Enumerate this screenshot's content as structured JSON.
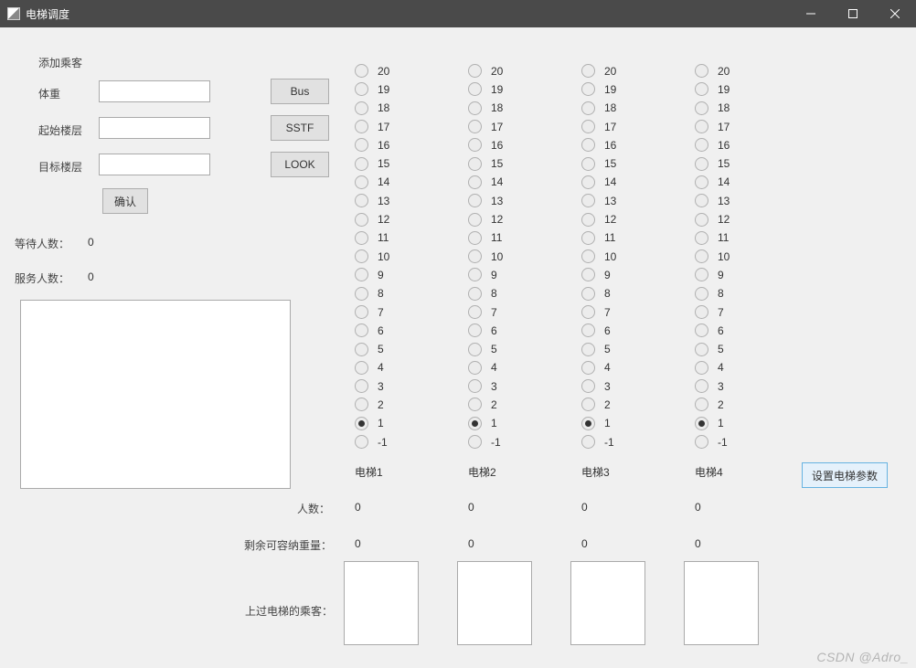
{
  "window": {
    "title": "电梯调度"
  },
  "panel": {
    "add_passenger": "添加乘客",
    "weight_label": "体重",
    "start_floor_label": "起始楼层",
    "target_floor_label": "目标楼层",
    "confirm": "确认"
  },
  "inputs": {
    "weight": "",
    "start_floor": "",
    "target_floor": ""
  },
  "algorithms": {
    "bus": "Bus",
    "sstf": "SSTF",
    "look": "LOOK"
  },
  "stats": {
    "waiting_label": "等待人数：",
    "served_label": "服务人数：",
    "waiting": "0",
    "served": "0"
  },
  "row_labels": {
    "count": "人数：",
    "remaining_weight": "剩余可容纳重量：",
    "boarded": "上过电梯的乘客："
  },
  "set_params_button": "设置电梯参数",
  "elevators": [
    {
      "name": "电梯1",
      "selected": 1,
      "count": "0",
      "remaining": "0"
    },
    {
      "name": "电梯2",
      "selected": 1,
      "count": "0",
      "remaining": "0"
    },
    {
      "name": "电梯3",
      "selected": 1,
      "count": "0",
      "remaining": "0"
    },
    {
      "name": "电梯4",
      "selected": 1,
      "count": "0",
      "remaining": "0"
    }
  ],
  "floors": [
    20,
    19,
    18,
    17,
    16,
    15,
    14,
    13,
    12,
    11,
    10,
    9,
    8,
    7,
    6,
    5,
    4,
    3,
    2,
    1,
    -1
  ],
  "watermark": "CSDN @Adro_"
}
